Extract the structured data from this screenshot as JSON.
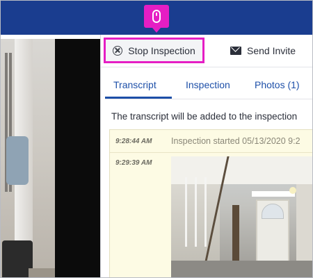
{
  "toolbar": {
    "stop_label": "Stop Inspection",
    "stop_icon": "circle-x-icon",
    "invite_label": "Send Invite",
    "invite_icon": "envelope-icon",
    "highlight_color": "#e51ec4"
  },
  "tabs": [
    {
      "label": "Transcript",
      "active": true
    },
    {
      "label": "Inspection",
      "active": false
    },
    {
      "label": "Photos (1)",
      "active": false
    }
  ],
  "transcript": {
    "note": "The transcript will be added to the inspection",
    "entries": [
      {
        "time": "9:28:44 AM",
        "text": "Inspection started 05/13/2020 9:2"
      },
      {
        "time": "9:29:39 AM",
        "text": "",
        "has_photo": true
      }
    ]
  },
  "colors": {
    "header": "#1a3d8f",
    "tab_active": "#1d4fa8",
    "transcript_bg": "#fdfbe4"
  },
  "cursor_indicator": {
    "icon": "mouse-icon"
  }
}
